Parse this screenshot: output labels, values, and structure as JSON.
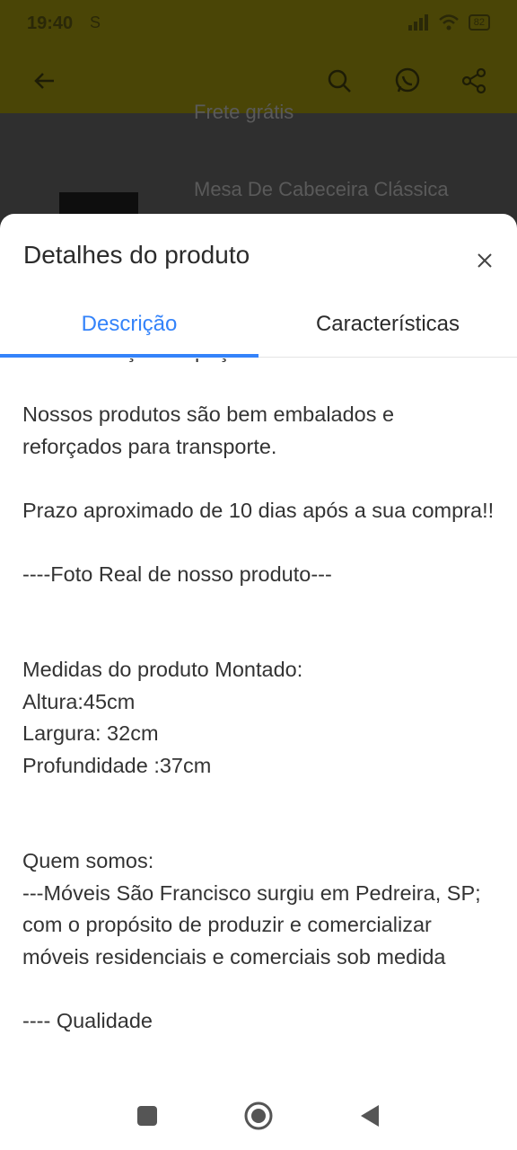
{
  "status_bar": {
    "time": "19:40",
    "left_icons": "S",
    "battery": "82"
  },
  "background_app": {
    "shipping_text": "Frete grátis",
    "product_title": "Mesa De Cabeceira Clássica"
  },
  "sheet": {
    "title": "Detalhes do produto",
    "close_icon": "close-icon",
    "tabs": [
      {
        "label": "Descrição",
        "active": true
      },
      {
        "label": "Características",
        "active": false
      }
    ],
    "description": "movimentação da peça.\n\nNossos produtos são bem embalados e reforçados para transporte.\n\nPrazo aproximado de 10 dias após a sua compra!!\n\n----Foto Real de nosso produto---\n\n\nMedidas do produto Montado:\nAltura:45cm\nLargura: 32cm\nProfundidade :37cm\n\n\nQuem somos:\n---Móveis São Francisco surgiu em Pedreira, SP; com o propósito de produzir e comercializar móveis residenciais e comerciais sob medida\n\n---- Qualidade"
  },
  "colors": {
    "accent": "#3483fa",
    "text": "#333333",
    "appbar_dimmed": "#4a4506"
  },
  "navigation": {
    "icons": [
      "recents-icon",
      "home-icon",
      "back-icon"
    ]
  }
}
